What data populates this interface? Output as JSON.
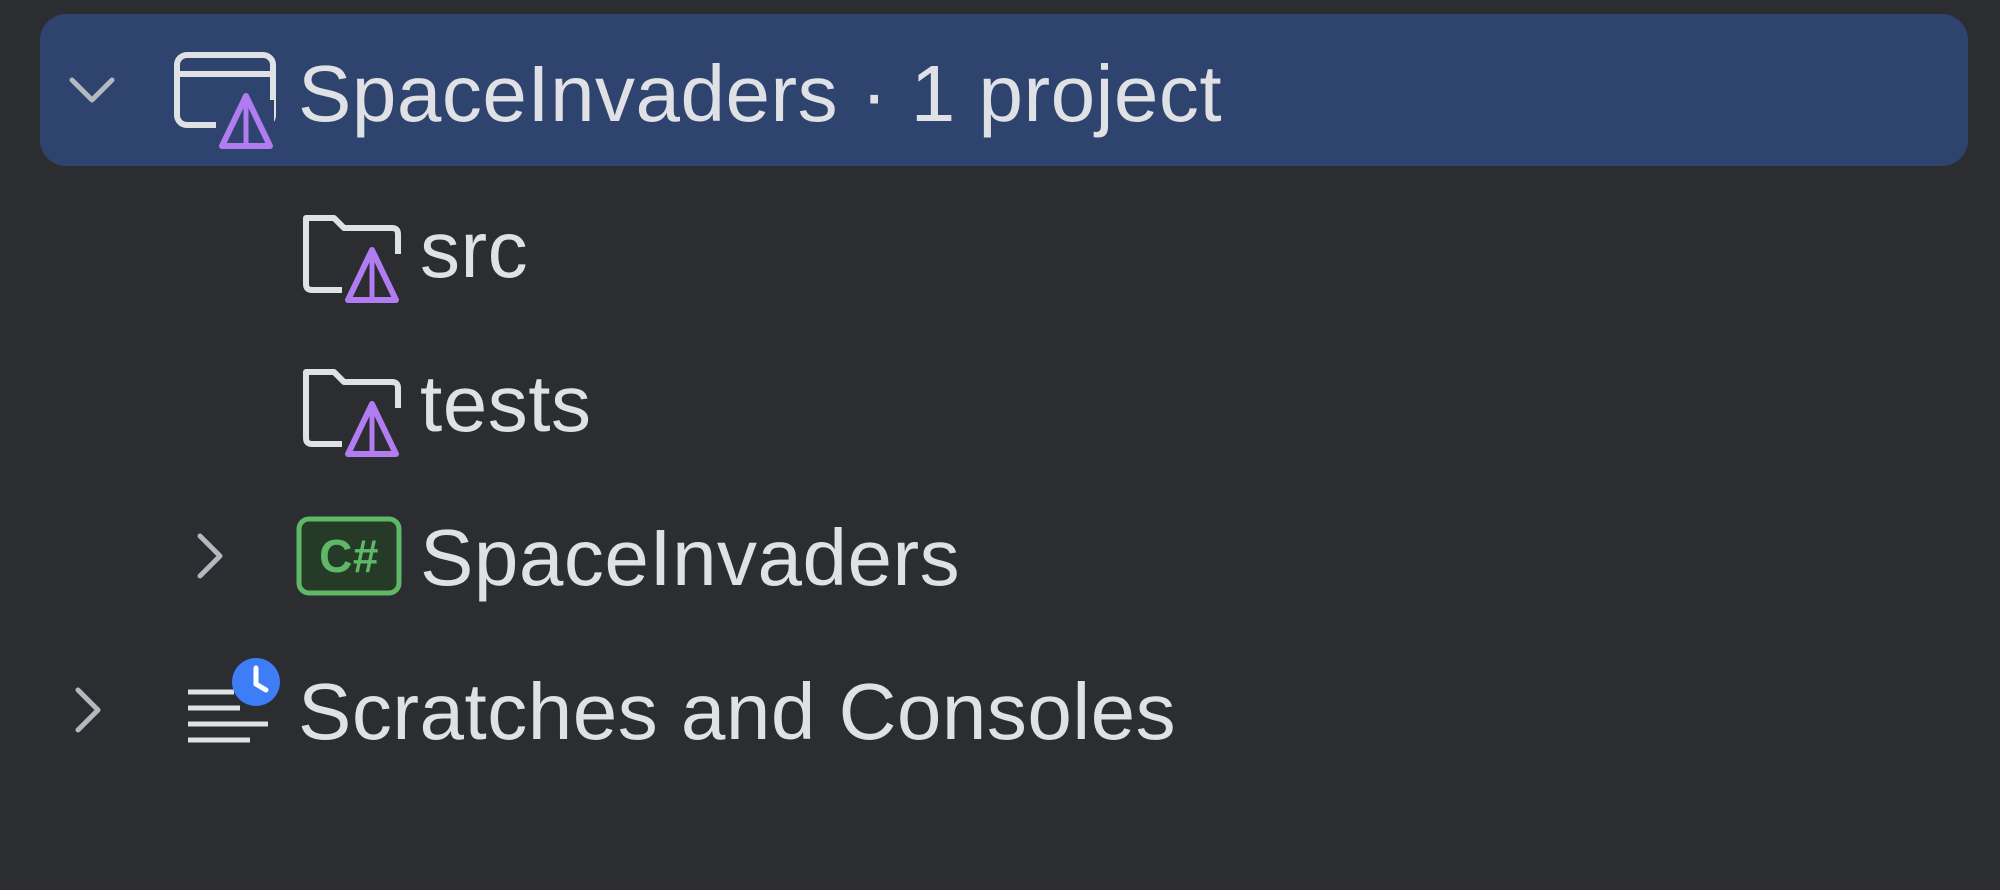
{
  "tree": {
    "solution": {
      "label": "SpaceInvaders · 1 project",
      "expanded": true,
      "icon": "solution-icon"
    },
    "folders": [
      {
        "label": "src",
        "icon": "solution-folder-icon"
      },
      {
        "label": "tests",
        "icon": "solution-folder-icon"
      }
    ],
    "project": {
      "label": "SpaceInvaders",
      "expanded": false,
      "icon": "csharp-project-icon",
      "icon_text": "C#"
    },
    "scratches": {
      "label": "Scratches and Consoles",
      "expanded": false,
      "icon": "scratches-icon"
    }
  },
  "colors": {
    "background": "#2b2d30",
    "selection": "#2e436e",
    "text": "#dfe1e5",
    "accent_purple": "#b07cf0",
    "csharp_green": "#5fb865",
    "badge_blue": "#3d7df5"
  }
}
